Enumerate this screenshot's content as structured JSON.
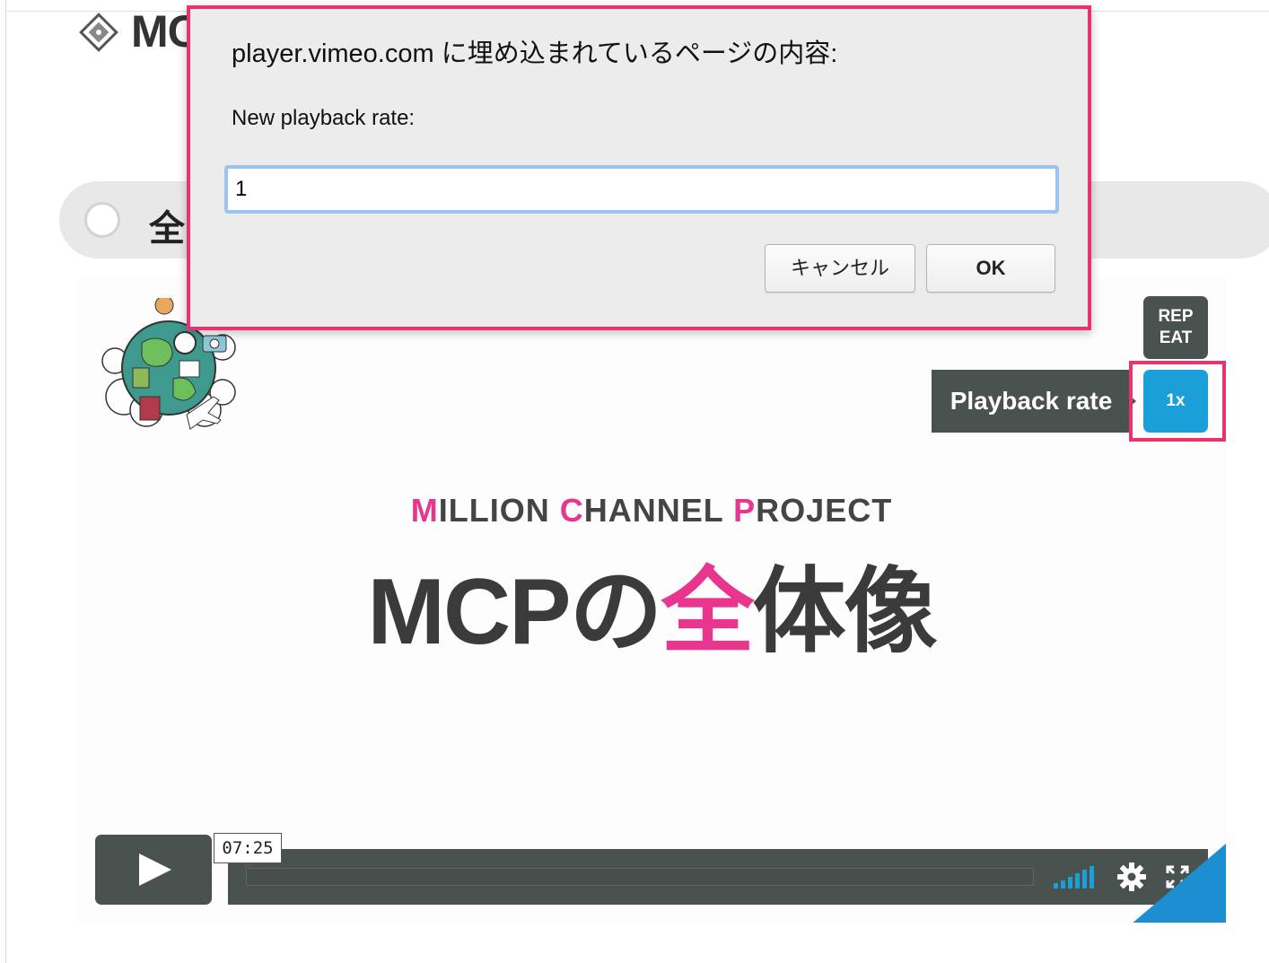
{
  "page": {
    "heading": "MC",
    "toggle_label": "全"
  },
  "dialog": {
    "title": "player.vimeo.com に埋め込まれているページの内容:",
    "message": "New playback rate:",
    "input_value": "1",
    "cancel_label": "キャンセル",
    "ok_label": "OK"
  },
  "video": {
    "title_sub": {
      "m": "M",
      "m_rest": "ILLION ",
      "c": "C",
      "c_rest": "HANNEL ",
      "p": "P",
      "p_rest": "ROJECT"
    },
    "title_main": {
      "before": "MCPの",
      "highlight": "全",
      "after": "体像"
    },
    "repeat_label_1": "REP",
    "repeat_label_2": "EAT",
    "playback_rate_label": "Playback rate",
    "playback_rate_value": "1x",
    "time": "07:25",
    "progress": 0
  },
  "colors": {
    "accent_pink": "#e8358e",
    "highlight_border": "#e8336e",
    "vimeo_blue": "#1a9fd9",
    "control_bg": "#4a5250"
  },
  "icons": [
    "page-logo-icon",
    "globe-illustration",
    "play-icon",
    "volume-icon",
    "gear-icon",
    "fullscreen-icon"
  ]
}
